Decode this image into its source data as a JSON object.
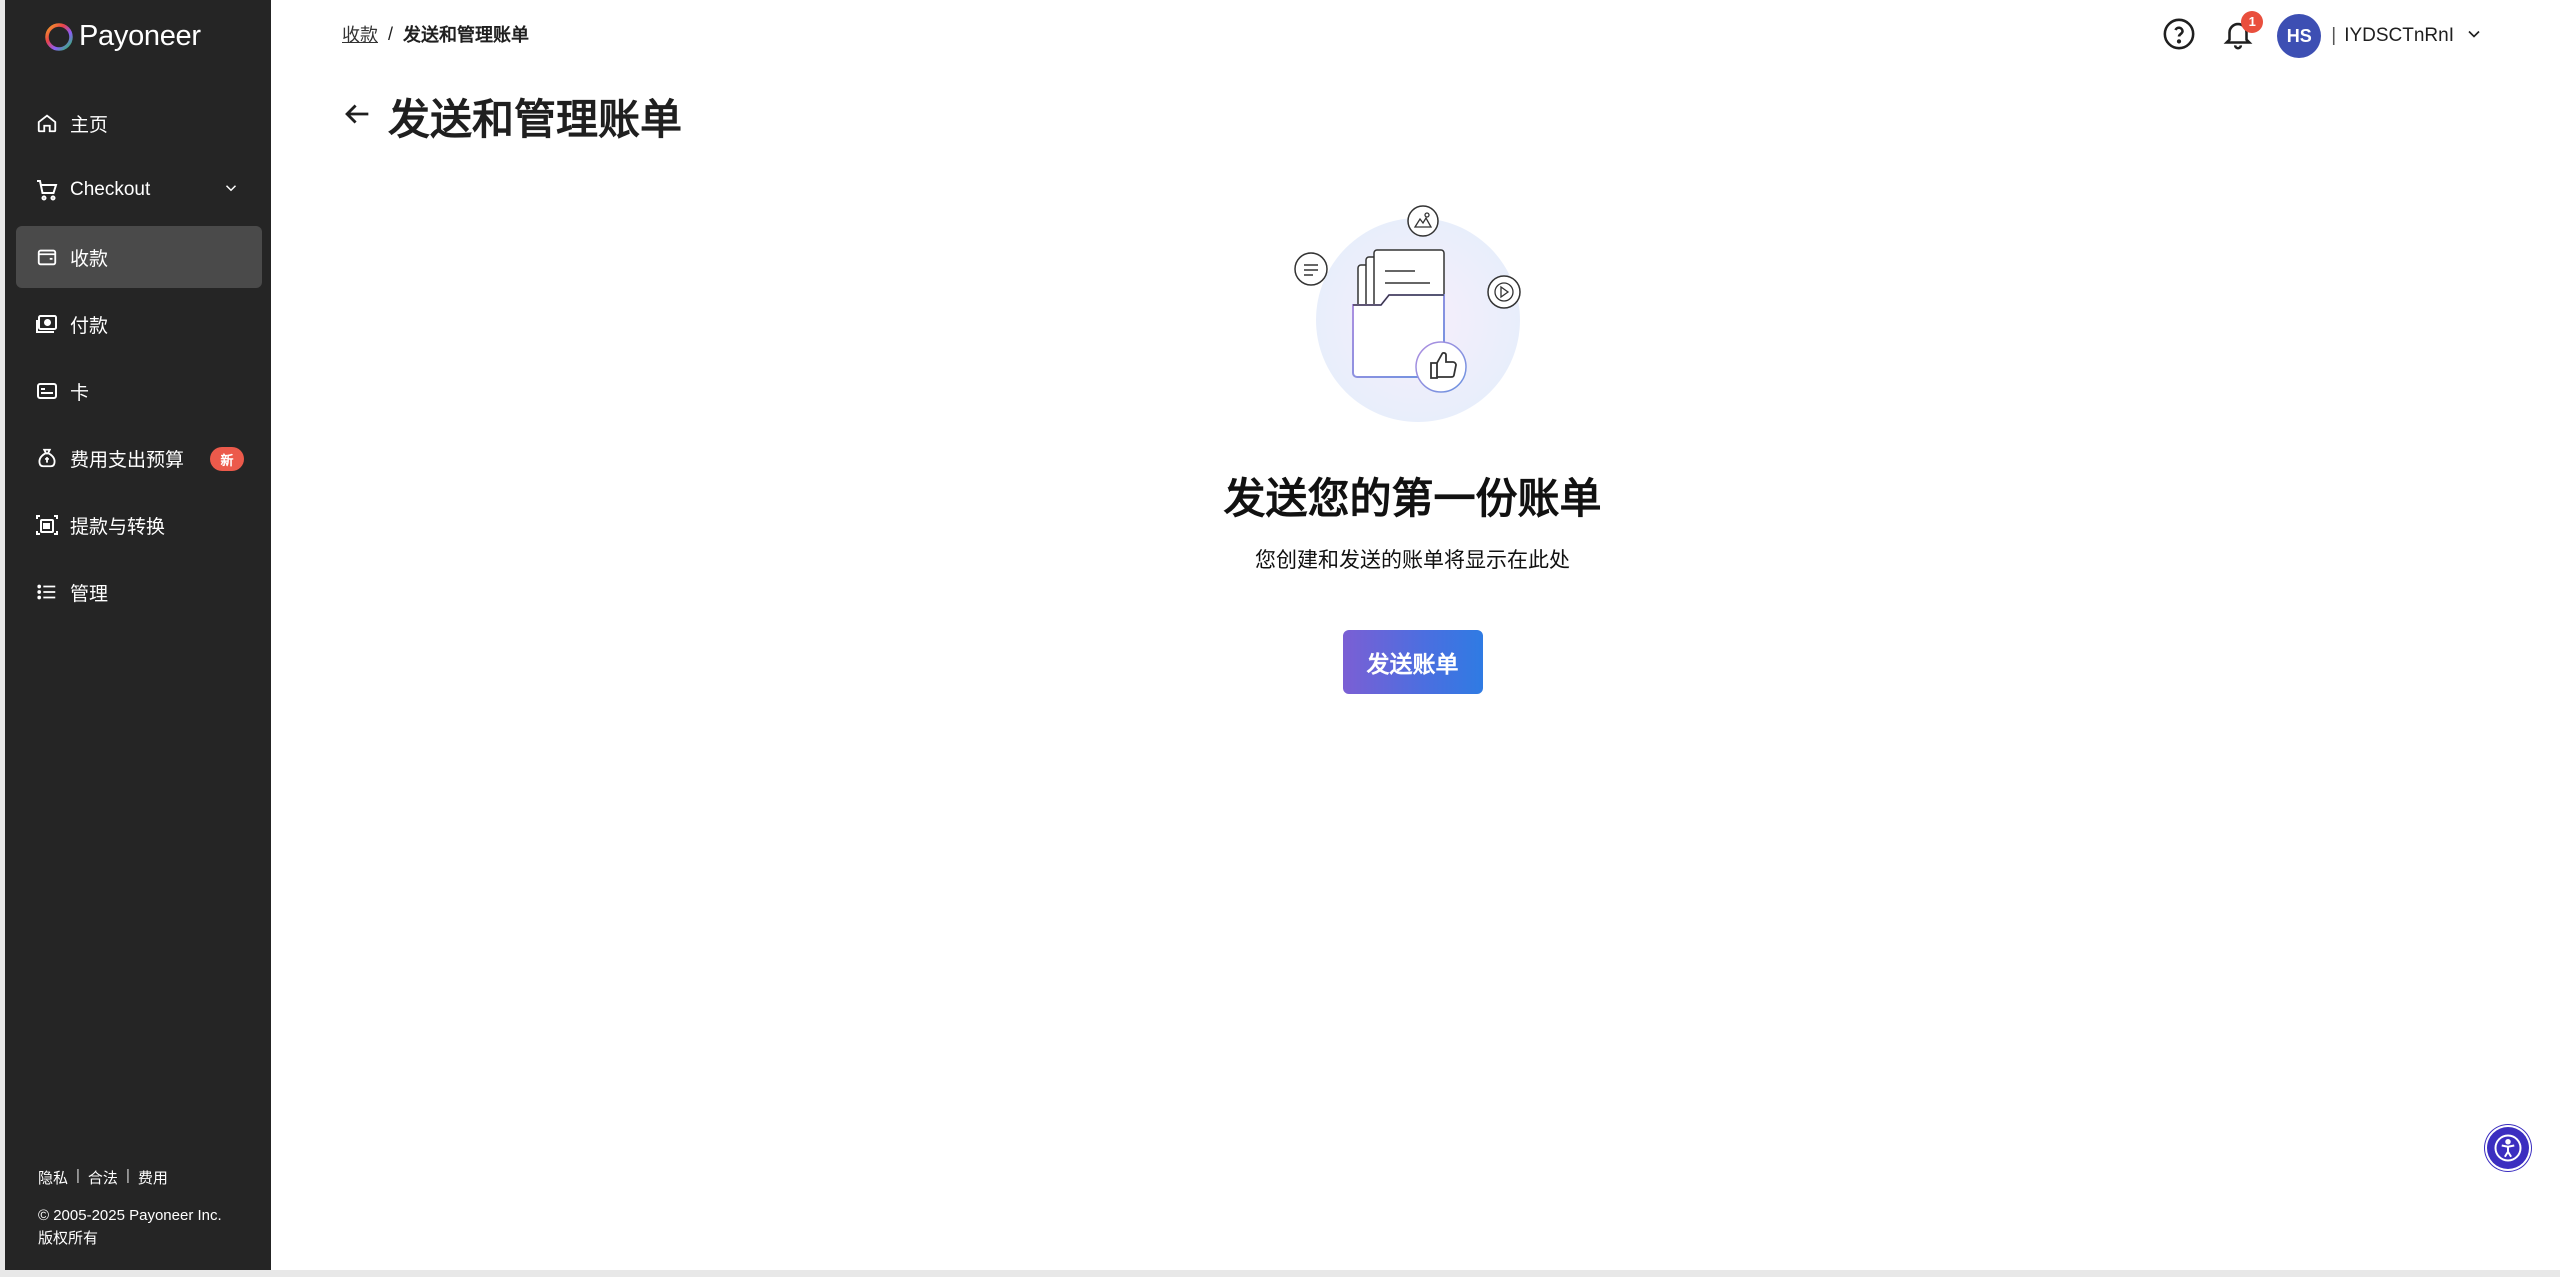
{
  "brand": {
    "name": "Payoneer"
  },
  "sidebar": {
    "items": [
      {
        "label": "主页",
        "icon": "home-icon"
      },
      {
        "label": "Checkout",
        "icon": "cart-icon"
      },
      {
        "label": "收款",
        "icon": "wallet-icon",
        "active": true
      },
      {
        "label": "付款",
        "icon": "payment-icon"
      },
      {
        "label": "卡",
        "icon": "card-icon"
      },
      {
        "label": "费用支出预算",
        "icon": "money-bag-icon",
        "badge": "新"
      },
      {
        "label": "提款与转换",
        "icon": "withdraw-icon"
      },
      {
        "label": "管理",
        "icon": "list-icon"
      }
    ],
    "footer_links": [
      "隐私",
      "合法",
      "费用"
    ],
    "copyright_line1": "© 2005-2025 Payoneer Inc.",
    "copyright_line2": "版权所有"
  },
  "breadcrumb": {
    "parent": "收款",
    "separator": "/",
    "current": "发送和管理账单"
  },
  "page": {
    "title": "发送和管理账单"
  },
  "topbar": {
    "notification_count": "1",
    "avatar_initials": "HS",
    "user_separator": "|",
    "username": "IYDSCTnRnI"
  },
  "empty_state": {
    "title": "发送您的第一份账单",
    "subtitle": "您创建和发送的账单将显示在此处",
    "button_label": "发送账单"
  },
  "colors": {
    "sidebar_bg": "#252525",
    "sidebar_active": "#4a4a4a",
    "badge_red": "#ec5a4b",
    "avatar_blue": "#3d4fb3",
    "cta_gradient_start": "#7b5fd4",
    "cta_gradient_end": "#2f7be3"
  }
}
